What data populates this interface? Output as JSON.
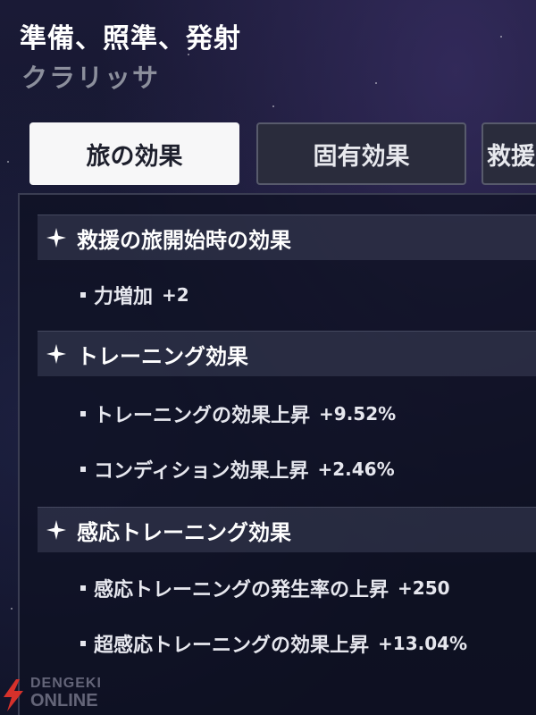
{
  "header": {
    "title": "準備、照準、発射",
    "subtitle": "クラリッサ"
  },
  "tabs": [
    {
      "label": "旅の効果",
      "active": true
    },
    {
      "label": "固有効果",
      "active": false
    },
    {
      "label": "救援",
      "active": false
    }
  ],
  "sections": [
    {
      "icon": "sparkle-icon",
      "label": "救援の旅開始時の効果",
      "items": [
        {
          "text": "力増加",
          "value": "+2"
        }
      ]
    },
    {
      "icon": "sparkle-icon",
      "label": "トレーニング効果",
      "items": [
        {
          "text": "トレーニングの効果上昇",
          "value": "+9.52%"
        },
        {
          "text": "コンディション効果上昇",
          "value": "+2.46%"
        }
      ]
    },
    {
      "icon": "sparkle-icon",
      "label": "感応トレーニング効果",
      "items": [
        {
          "text": "感応トレーニングの発生率の上昇",
          "value": "+250"
        },
        {
          "text": "超感応トレーニングの効果上昇",
          "value": "+13.04%"
        }
      ]
    }
  ],
  "watermark": {
    "line1": "DENGEKI",
    "line2": "ONLINE"
  },
  "colors": {
    "background": "#0f1225",
    "active_tab": "#f7f7f8",
    "inactive_tab": "#2a2c3c",
    "watermark_red": "#d6312b"
  }
}
